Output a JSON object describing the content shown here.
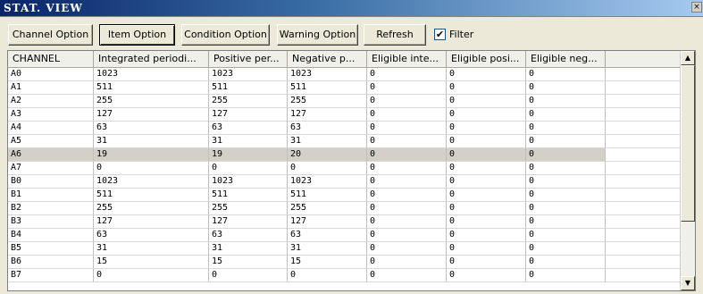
{
  "window": {
    "title": "STAT. VIEW",
    "close_glyph": "×"
  },
  "toolbar": {
    "buttons": [
      {
        "label": "Channel Option"
      },
      {
        "label": "Item Option"
      },
      {
        "label": "Condition Option"
      },
      {
        "label": "Warning Option"
      },
      {
        "label": "Refresh"
      }
    ],
    "filter": {
      "label": "Filter",
      "checked": true,
      "check_glyph": "✔"
    }
  },
  "grid": {
    "columns": [
      "CHANNEL",
      "Integrated periodi...",
      "Positive per...",
      "Negative p...",
      "Eligible inte...",
      "Eligible posi...",
      "Eligible neg...",
      ""
    ],
    "rows": [
      [
        "A0",
        "1023",
        "1023",
        "1023",
        "0",
        "0",
        "0",
        ""
      ],
      [
        "A1",
        "511",
        "511",
        "511",
        "0",
        "0",
        "0",
        ""
      ],
      [
        "A2",
        "255",
        "255",
        "255",
        "0",
        "0",
        "0",
        ""
      ],
      [
        "A3",
        "127",
        "127",
        "127",
        "0",
        "0",
        "0",
        ""
      ],
      [
        "A4",
        "63",
        "63",
        "63",
        "0",
        "0",
        "0",
        ""
      ],
      [
        "A5",
        "31",
        "31",
        "31",
        "0",
        "0",
        "0",
        ""
      ],
      [
        "A6",
        "19",
        "19",
        "20",
        "0",
        "0",
        "0",
        ""
      ],
      [
        "A7",
        "0",
        "0",
        "0",
        "0",
        "0",
        "0",
        ""
      ],
      [
        "B0",
        "1023",
        "1023",
        "1023",
        "0",
        "0",
        "0",
        ""
      ],
      [
        "B1",
        "511",
        "511",
        "511",
        "0",
        "0",
        "0",
        ""
      ],
      [
        "B2",
        "255",
        "255",
        "255",
        "0",
        "0",
        "0",
        ""
      ],
      [
        "B3",
        "127",
        "127",
        "127",
        "0",
        "0",
        "0",
        ""
      ],
      [
        "B4",
        "63",
        "63",
        "63",
        "0",
        "0",
        "0",
        ""
      ],
      [
        "B5",
        "31",
        "31",
        "31",
        "0",
        "0",
        "0",
        ""
      ],
      [
        "B6",
        "15",
        "15",
        "15",
        "0",
        "0",
        "0",
        ""
      ],
      [
        "B7",
        "0",
        "0",
        "0",
        "0",
        "0",
        "0",
        ""
      ]
    ],
    "selected_row": "A6"
  },
  "scrollbar": {
    "up_glyph": "▲",
    "down_glyph": "▼"
  }
}
